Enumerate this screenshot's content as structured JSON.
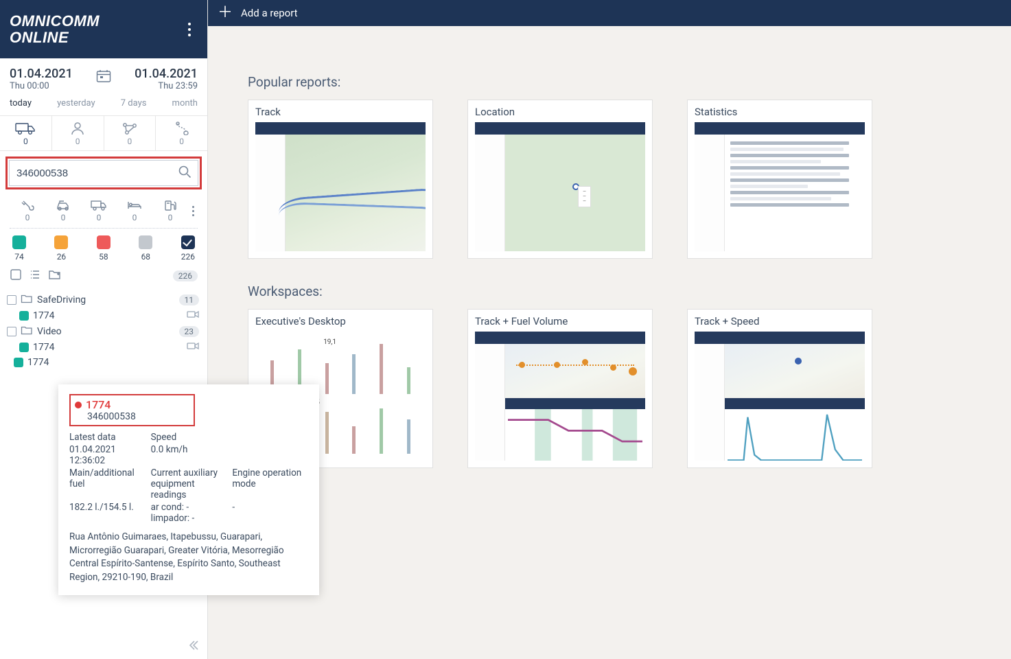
{
  "brand": {
    "line1": "OMNICOMM",
    "line2": "ONLINE"
  },
  "topbar": {
    "add_report": "Add a report"
  },
  "date": {
    "from_date": "01.04.2021",
    "from_day": "Thu  00:00",
    "to_date": "01.04.2021",
    "to_day": "Thu  23:59",
    "presets": {
      "today": "today",
      "yesterday": "yesterday",
      "week": "7 days",
      "month": "month"
    },
    "active_preset": "today"
  },
  "selector_tabs": {
    "vehicles": {
      "count": "0"
    },
    "drivers": {
      "count": "0"
    },
    "geozones": {
      "count": "0"
    },
    "routes": {
      "count": "0"
    }
  },
  "search": {
    "value": "346000538"
  },
  "filters": {
    "maint": "0",
    "events": "0",
    "vehicles": "0",
    "rest": "0",
    "fuel": "0"
  },
  "status": {
    "green": "74",
    "orange": "26",
    "red": "58",
    "gray": "68",
    "checked": "226"
  },
  "totals_pill": "226",
  "tree": {
    "group1": {
      "name": "SafeDriving",
      "badge": "11",
      "child": "1774"
    },
    "group2": {
      "name": "Video",
      "badge": "23",
      "child": "1774"
    },
    "loose": "1774"
  },
  "content": {
    "popular_heading": "Popular reports:",
    "workspaces_heading": "Workspaces:",
    "popular": [
      {
        "title": "Track"
      },
      {
        "title": "Location"
      },
      {
        "title": "Statistics"
      }
    ],
    "workspaces": [
      {
        "title": "Executive's Desktop"
      },
      {
        "title": "Track + Fuel Volume"
      },
      {
        "title": "Track + Speed"
      }
    ]
  },
  "tooltip": {
    "id": "1774",
    "sub": "346000538",
    "row1": {
      "latest_lbl": "Latest data",
      "speed_lbl": "Speed"
    },
    "row2": {
      "latest_val": "01.04.2021 12:36:02",
      "speed_val": "0.0 km/h"
    },
    "row3": {
      "fuel_lbl": "Main/additional fuel",
      "aux_lbl": "Current auxiliary equipment readings",
      "engine_lbl": "Engine operation mode"
    },
    "row4": {
      "fuel_val": "182.2 l./154.5 l.",
      "aux_val1": "ar cond: -",
      "aux_val2": "limpador: -",
      "engine_val": "-"
    },
    "address": "Rua Antônio Guimaraes, Itapebussu, Guarapari, Microrregião Guarapari, Greater Vitória, Mesorregião Central Espírito-Santense, Espírito Santo, Southeast Region, 29210-190, Brazil"
  }
}
